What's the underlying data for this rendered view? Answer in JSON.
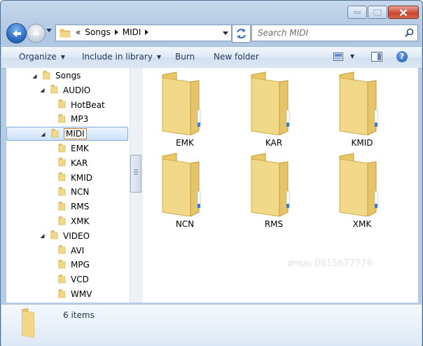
{
  "address": {
    "crumbs": [
      "«",
      "Songs",
      "MIDI"
    ]
  },
  "search": {
    "placeholder": "Search MIDI"
  },
  "toolbar": {
    "organize": "Organize",
    "include_in_library": "Include in library",
    "burn": "Burn",
    "new_folder": "New folder"
  },
  "nav_tree": [
    {
      "label": "Songs",
      "indent": 0,
      "expander": "expanded",
      "selected": false
    },
    {
      "label": "AUDIO",
      "indent": 1,
      "expander": "expanded",
      "selected": false
    },
    {
      "label": "HotBeat",
      "indent": 2,
      "expander": "none",
      "selected": false
    },
    {
      "label": "MP3",
      "indent": 2,
      "expander": "none",
      "selected": false
    },
    {
      "label": "MIDI",
      "indent": 1,
      "expander": "expanded",
      "selected": true
    },
    {
      "label": "EMK",
      "indent": 2,
      "expander": "none",
      "selected": false
    },
    {
      "label": "KAR",
      "indent": 2,
      "expander": "none",
      "selected": false
    },
    {
      "label": "KMID",
      "indent": 2,
      "expander": "none",
      "selected": false
    },
    {
      "label": "NCN",
      "indent": 2,
      "expander": "none",
      "selected": false
    },
    {
      "label": "RMS",
      "indent": 2,
      "expander": "none",
      "selected": false
    },
    {
      "label": "XMK",
      "indent": 2,
      "expander": "none",
      "selected": false
    },
    {
      "label": "VIDEO",
      "indent": 1,
      "expander": "expanded",
      "selected": false
    },
    {
      "label": "AVI",
      "indent": 2,
      "expander": "none",
      "selected": false
    },
    {
      "label": "MPG",
      "indent": 2,
      "expander": "none",
      "selected": false
    },
    {
      "label": "VCD",
      "indent": 2,
      "expander": "none",
      "selected": false
    },
    {
      "label": "WMV",
      "indent": 2,
      "expander": "none",
      "selected": false
    }
  ],
  "folders": [
    {
      "name": "EMK",
      "has_documents": false
    },
    {
      "name": "KAR",
      "has_documents": false
    },
    {
      "name": "KMID",
      "has_documents": false
    },
    {
      "name": "NCN",
      "has_documents": true
    },
    {
      "name": "RMS",
      "has_documents": false
    },
    {
      "name": "XMK",
      "has_documents": false
    }
  ],
  "watermark": "ສາພຄ 0815677776",
  "details": {
    "count_text": "6 items"
  },
  "colors": {
    "folder_front": "#f2d98a",
    "folder_back": "#e9c767",
    "selection": "#cde3fa",
    "rename_box": "#e1731b"
  }
}
